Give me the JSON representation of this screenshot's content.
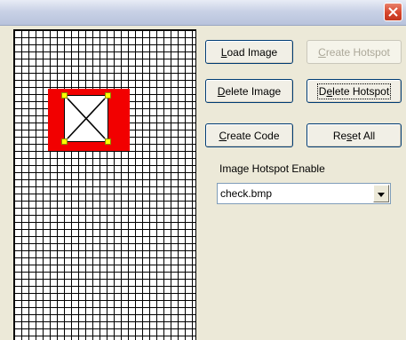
{
  "window": {
    "close_icon": "close-icon"
  },
  "buttons": {
    "load_image": {
      "pre": "",
      "accel": "L",
      "post": "oad Image"
    },
    "create_hotspot": {
      "pre": "",
      "accel": "C",
      "post": "reate Hotspot"
    },
    "delete_image": {
      "pre": "",
      "accel": "D",
      "post": "elete Image"
    },
    "delete_hotspot": {
      "pre": "D",
      "accel": "e",
      "post": "lete Hotspot"
    },
    "create_code": {
      "pre": "",
      "accel": "C",
      "post": "reate Code"
    },
    "reset_all": {
      "pre": "Re",
      "accel": "s",
      "post": "et All"
    }
  },
  "hotspot_panel": {
    "label": "Image Hotspot Enable",
    "selected": "check.bmp"
  },
  "colors": {
    "image_fill": "#f20000",
    "handle_fill": "#ffff00",
    "close_button": "#d6462c"
  }
}
